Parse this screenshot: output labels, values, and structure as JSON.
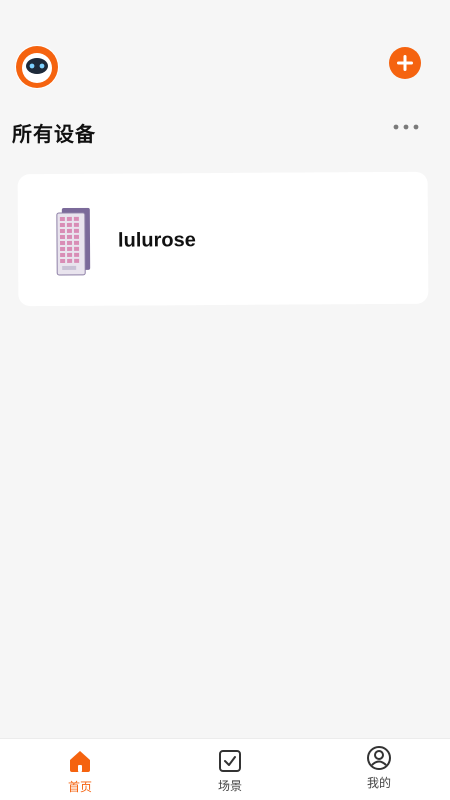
{
  "header": {
    "avatar_icon": "robot-avatar-icon",
    "add_icon": "plus-icon",
    "title": "所有设备",
    "more_icon": "more-dots-icon"
  },
  "devices": [
    {
      "name": "lulurose",
      "thumbnail_icon": "tablet-device-icon"
    }
  ],
  "nav": {
    "items": [
      {
        "label": "首页",
        "icon": "home-icon",
        "active": true
      },
      {
        "label": "场景",
        "icon": "checkbox-icon",
        "active": false
      },
      {
        "label": "我的",
        "icon": "user-circle-icon",
        "active": false
      }
    ]
  },
  "colors": {
    "accent": "#f5630f",
    "background": "#f6f6f6",
    "card": "#ffffff",
    "text": "#111111"
  }
}
